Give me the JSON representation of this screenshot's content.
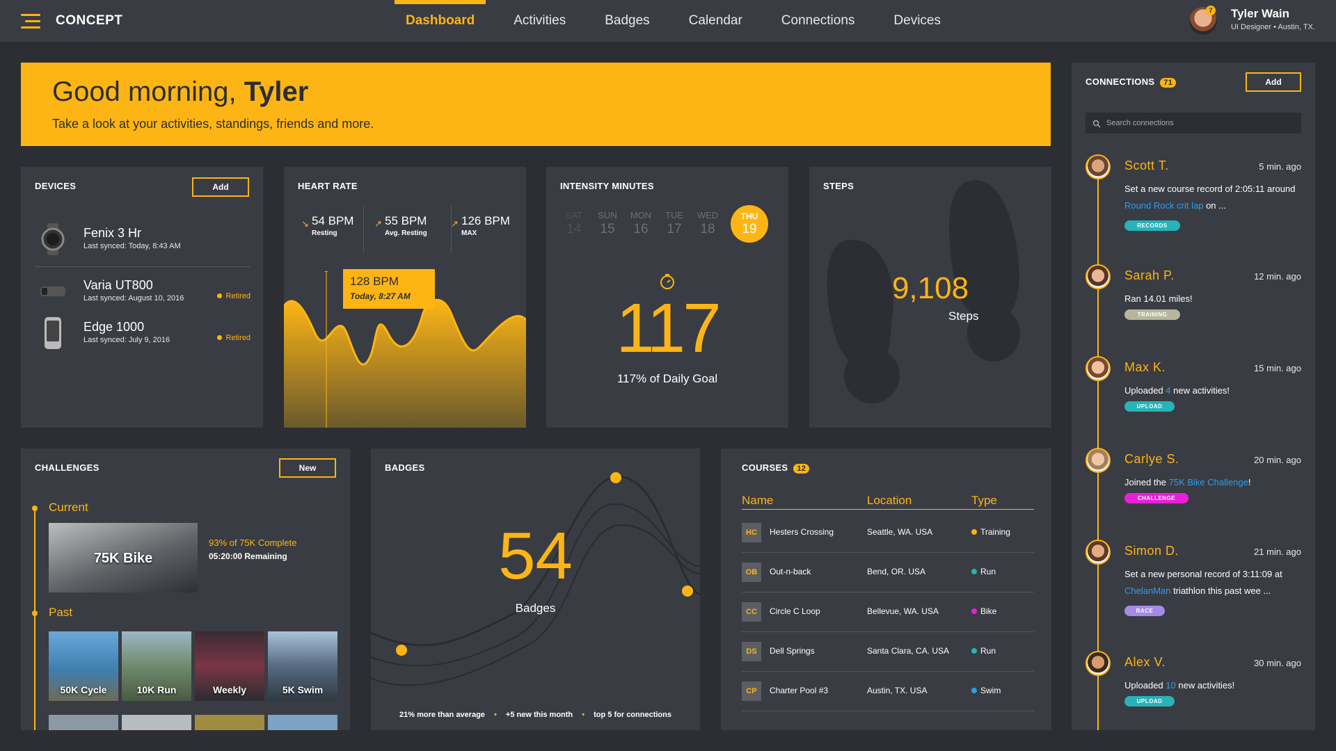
{
  "app": {
    "brand": "CONCEPT"
  },
  "nav": {
    "items": [
      "Dashboard",
      "Activities",
      "Badges",
      "Calendar",
      "Connections",
      "Devices"
    ],
    "active": "Dashboard"
  },
  "user": {
    "name": "Tyler Wain",
    "subtitle": "UI Designer • Austin, TX.",
    "notifications": "7"
  },
  "greeting": {
    "prefix": "Good morning, ",
    "name": "Tyler",
    "subtitle": "Take a look at your activities, standings, friends and more."
  },
  "devices": {
    "title": "DEVICES",
    "add_label": "Add",
    "items": [
      {
        "name": "Fenix 3 Hr",
        "sync": "Last synced: Today, 8:43 AM",
        "status": "",
        "icon": "watch-icon"
      },
      {
        "name": "Varia UT800",
        "sync": "Last synced: August 10, 2016",
        "status": "Retired",
        "icon": "bike-light-icon"
      },
      {
        "name": "Edge 1000",
        "sync": "Last synced: July 9, 2016",
        "status": "Retired",
        "icon": "bike-computer-icon"
      }
    ]
  },
  "heart_rate": {
    "title": "HEART RATE",
    "stats": [
      {
        "value": "54 BPM",
        "label": "Resting"
      },
      {
        "value": "55 BPM",
        "label": "Avg. Resting"
      },
      {
        "value": "126 BPM",
        "label": "MAX"
      }
    ],
    "tooltip": {
      "value": "128 BPM",
      "time": "Today, 8:27 AM"
    }
  },
  "intensity": {
    "title": "INTENSITY MINUTES",
    "days": [
      {
        "day": "SAT",
        "date": "14"
      },
      {
        "day": "SUN",
        "date": "15"
      },
      {
        "day": "MON",
        "date": "16"
      },
      {
        "day": "TUE",
        "date": "17"
      },
      {
        "day": "WED",
        "date": "18"
      },
      {
        "day": "THU",
        "date": "19"
      }
    ],
    "active_day": "THU",
    "value": "117",
    "goal": "117% of Daily Goal"
  },
  "steps": {
    "title": "STEPS",
    "value": "9,108",
    "label": "Steps"
  },
  "challenges": {
    "title": "CHALLENGES",
    "new_label": "New",
    "current_label": "Current",
    "past_label": "Past",
    "current": {
      "name": "75K Bike",
      "progress": "93% of 75K Complete",
      "remaining": "05:20:00 Remaining"
    },
    "past": [
      "50K Cycle",
      "10K Run",
      "Weekly",
      "5K Swim"
    ]
  },
  "badges": {
    "title": "BADGES",
    "value": "54",
    "label": "Badges",
    "footer": [
      "21% more than average",
      "+5 new this month",
      "top 5 for connections"
    ]
  },
  "courses": {
    "title": "COURSES",
    "count": "12",
    "headers": [
      "Name",
      "Location",
      "Type"
    ],
    "rows": [
      {
        "code": "HC",
        "name": "Hesters Crossing",
        "location": "Seattle, WA. USA",
        "type": "Training",
        "color": "#fdb515"
      },
      {
        "code": "OB",
        "name": "Out-n-back",
        "location": "Bend, OR. USA",
        "type": "Run",
        "color": "#27b3b7"
      },
      {
        "code": "CC",
        "name": "Circle C Loop",
        "location": "Bellevue, WA. USA",
        "type": "Bike",
        "color": "#e81fd8"
      },
      {
        "code": "DS",
        "name": "Dell Springs",
        "location": "Santa Clara, CA. USA",
        "type": "Run",
        "color": "#27b3b7"
      },
      {
        "code": "CP",
        "name": "Charter Pool #3",
        "location": "Austin, TX. USA",
        "type": "Swim",
        "color": "#2f9dea"
      }
    ]
  },
  "connections": {
    "title": "CONNECTIONS",
    "count": "71",
    "add_label": "Add",
    "search_placeholder": "Search connections",
    "items": [
      {
        "name": "Scott T.",
        "time": "5 min. ago",
        "text_pre": "Set a new course record of 2:05:11 around ",
        "link": "Round Rock crit lap",
        "text_post": "  on ...",
        "tag": "RECORDS",
        "tag_color": "#27b3b7"
      },
      {
        "name": "Sarah P.",
        "time": "12 min. ago",
        "text_pre": "Ran 14.01 miles!",
        "link": "",
        "text_post": "",
        "tag": "TRAINING",
        "tag_color": "#b6b59d"
      },
      {
        "name": "Max K.",
        "time": "15 min. ago",
        "text_pre": "Uploaded ",
        "link": "4",
        "text_post": " new activities!",
        "tag": "UPLOAD",
        "tag_color": "#27b3b7"
      },
      {
        "name": "Carlye S.",
        "time": "20 min. ago",
        "text_pre": "Joined the ",
        "link": "75K Bike Challenge",
        "text_post": "!",
        "tag": "CHALLENGE",
        "tag_color": "#e81fd8"
      },
      {
        "name": "Simon D.",
        "time": "21 min. ago",
        "text_pre": "Set a new personal record of 3:11:09 at ",
        "link": "ChelanMan",
        "text_post": " triathlon this past wee ...",
        "tag": "RACE",
        "tag_color": "#a68ae8"
      },
      {
        "name": "Alex V.",
        "time": "30 min. ago",
        "text_pre": "Uploaded ",
        "link": "10",
        "text_post": " new activities!",
        "tag": "UPLOAD",
        "tag_color": "#27b3b7"
      }
    ]
  },
  "colors": {
    "accent": "#fdb515",
    "panel": "#3a3c43",
    "background": "#2c2e33"
  }
}
